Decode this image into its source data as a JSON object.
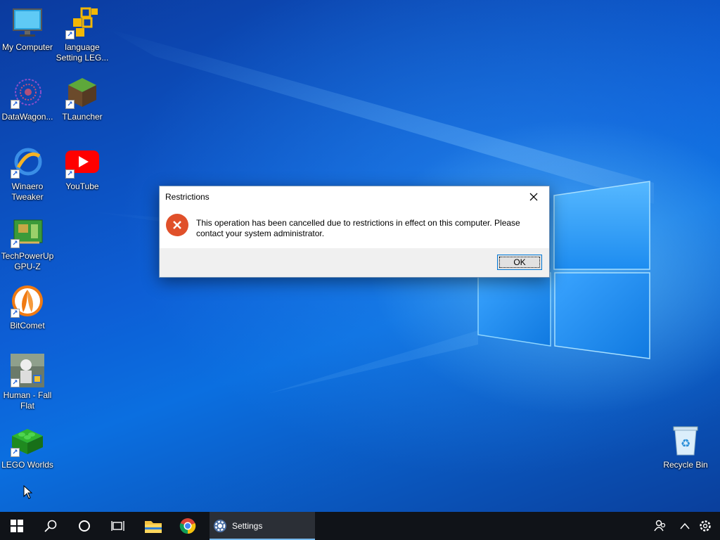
{
  "desktop": {
    "icons": [
      {
        "id": "my-computer",
        "label": "My Computer",
        "icon": "monitor-icon"
      },
      {
        "id": "language-setting",
        "label": "language Setting LEG...",
        "icon": "language-setting-icon"
      },
      {
        "id": "datawagon",
        "label": "DataWagon...",
        "icon": "datawagon-icon"
      },
      {
        "id": "tlauncher",
        "label": "TLauncher",
        "icon": "tlauncher-icon"
      },
      {
        "id": "winaero",
        "label": "Winaero Tweaker",
        "icon": "winaero-icon"
      },
      {
        "id": "youtube",
        "label": "YouTube",
        "icon": "youtube-icon"
      },
      {
        "id": "gpuz",
        "label": "TechPowerUp GPU-Z",
        "icon": "gpuz-icon"
      },
      {
        "id": "bitcomet",
        "label": "BitComet",
        "icon": "bitcomet-icon"
      },
      {
        "id": "humanfallflat",
        "label": "Human - Fall Flat",
        "icon": "human-fall-flat-icon"
      },
      {
        "id": "legoworlds",
        "label": "LEGO Worlds",
        "icon": "lego-worlds-icon"
      },
      {
        "id": "recyclebin",
        "label": "Recycle Bin",
        "icon": "recycle-bin-icon"
      }
    ]
  },
  "dialog": {
    "title": "Restrictions",
    "message": "This operation has been cancelled due to restrictions in effect on this computer. Please contact your system administrator.",
    "ok_label": "OK",
    "icon": "error-icon"
  },
  "taskbar": {
    "start_icon": "windows-start-icon",
    "search_icon": "search-icon",
    "cortana_icon": "cortana-icon",
    "taskview_icon": "task-view-icon",
    "pinned": [
      {
        "name": "file-explorer",
        "icon": "folder-icon"
      },
      {
        "name": "chrome",
        "icon": "chrome-icon"
      }
    ],
    "active_app": {
      "label": "Settings",
      "icon": "gear-icon"
    },
    "tray": [
      "people-icon",
      "chevron-up-icon",
      "settings-icon"
    ]
  },
  "colors": {
    "taskbar_bg": "#101318",
    "accent": "#0078d7",
    "error_red": "#e0502a"
  }
}
